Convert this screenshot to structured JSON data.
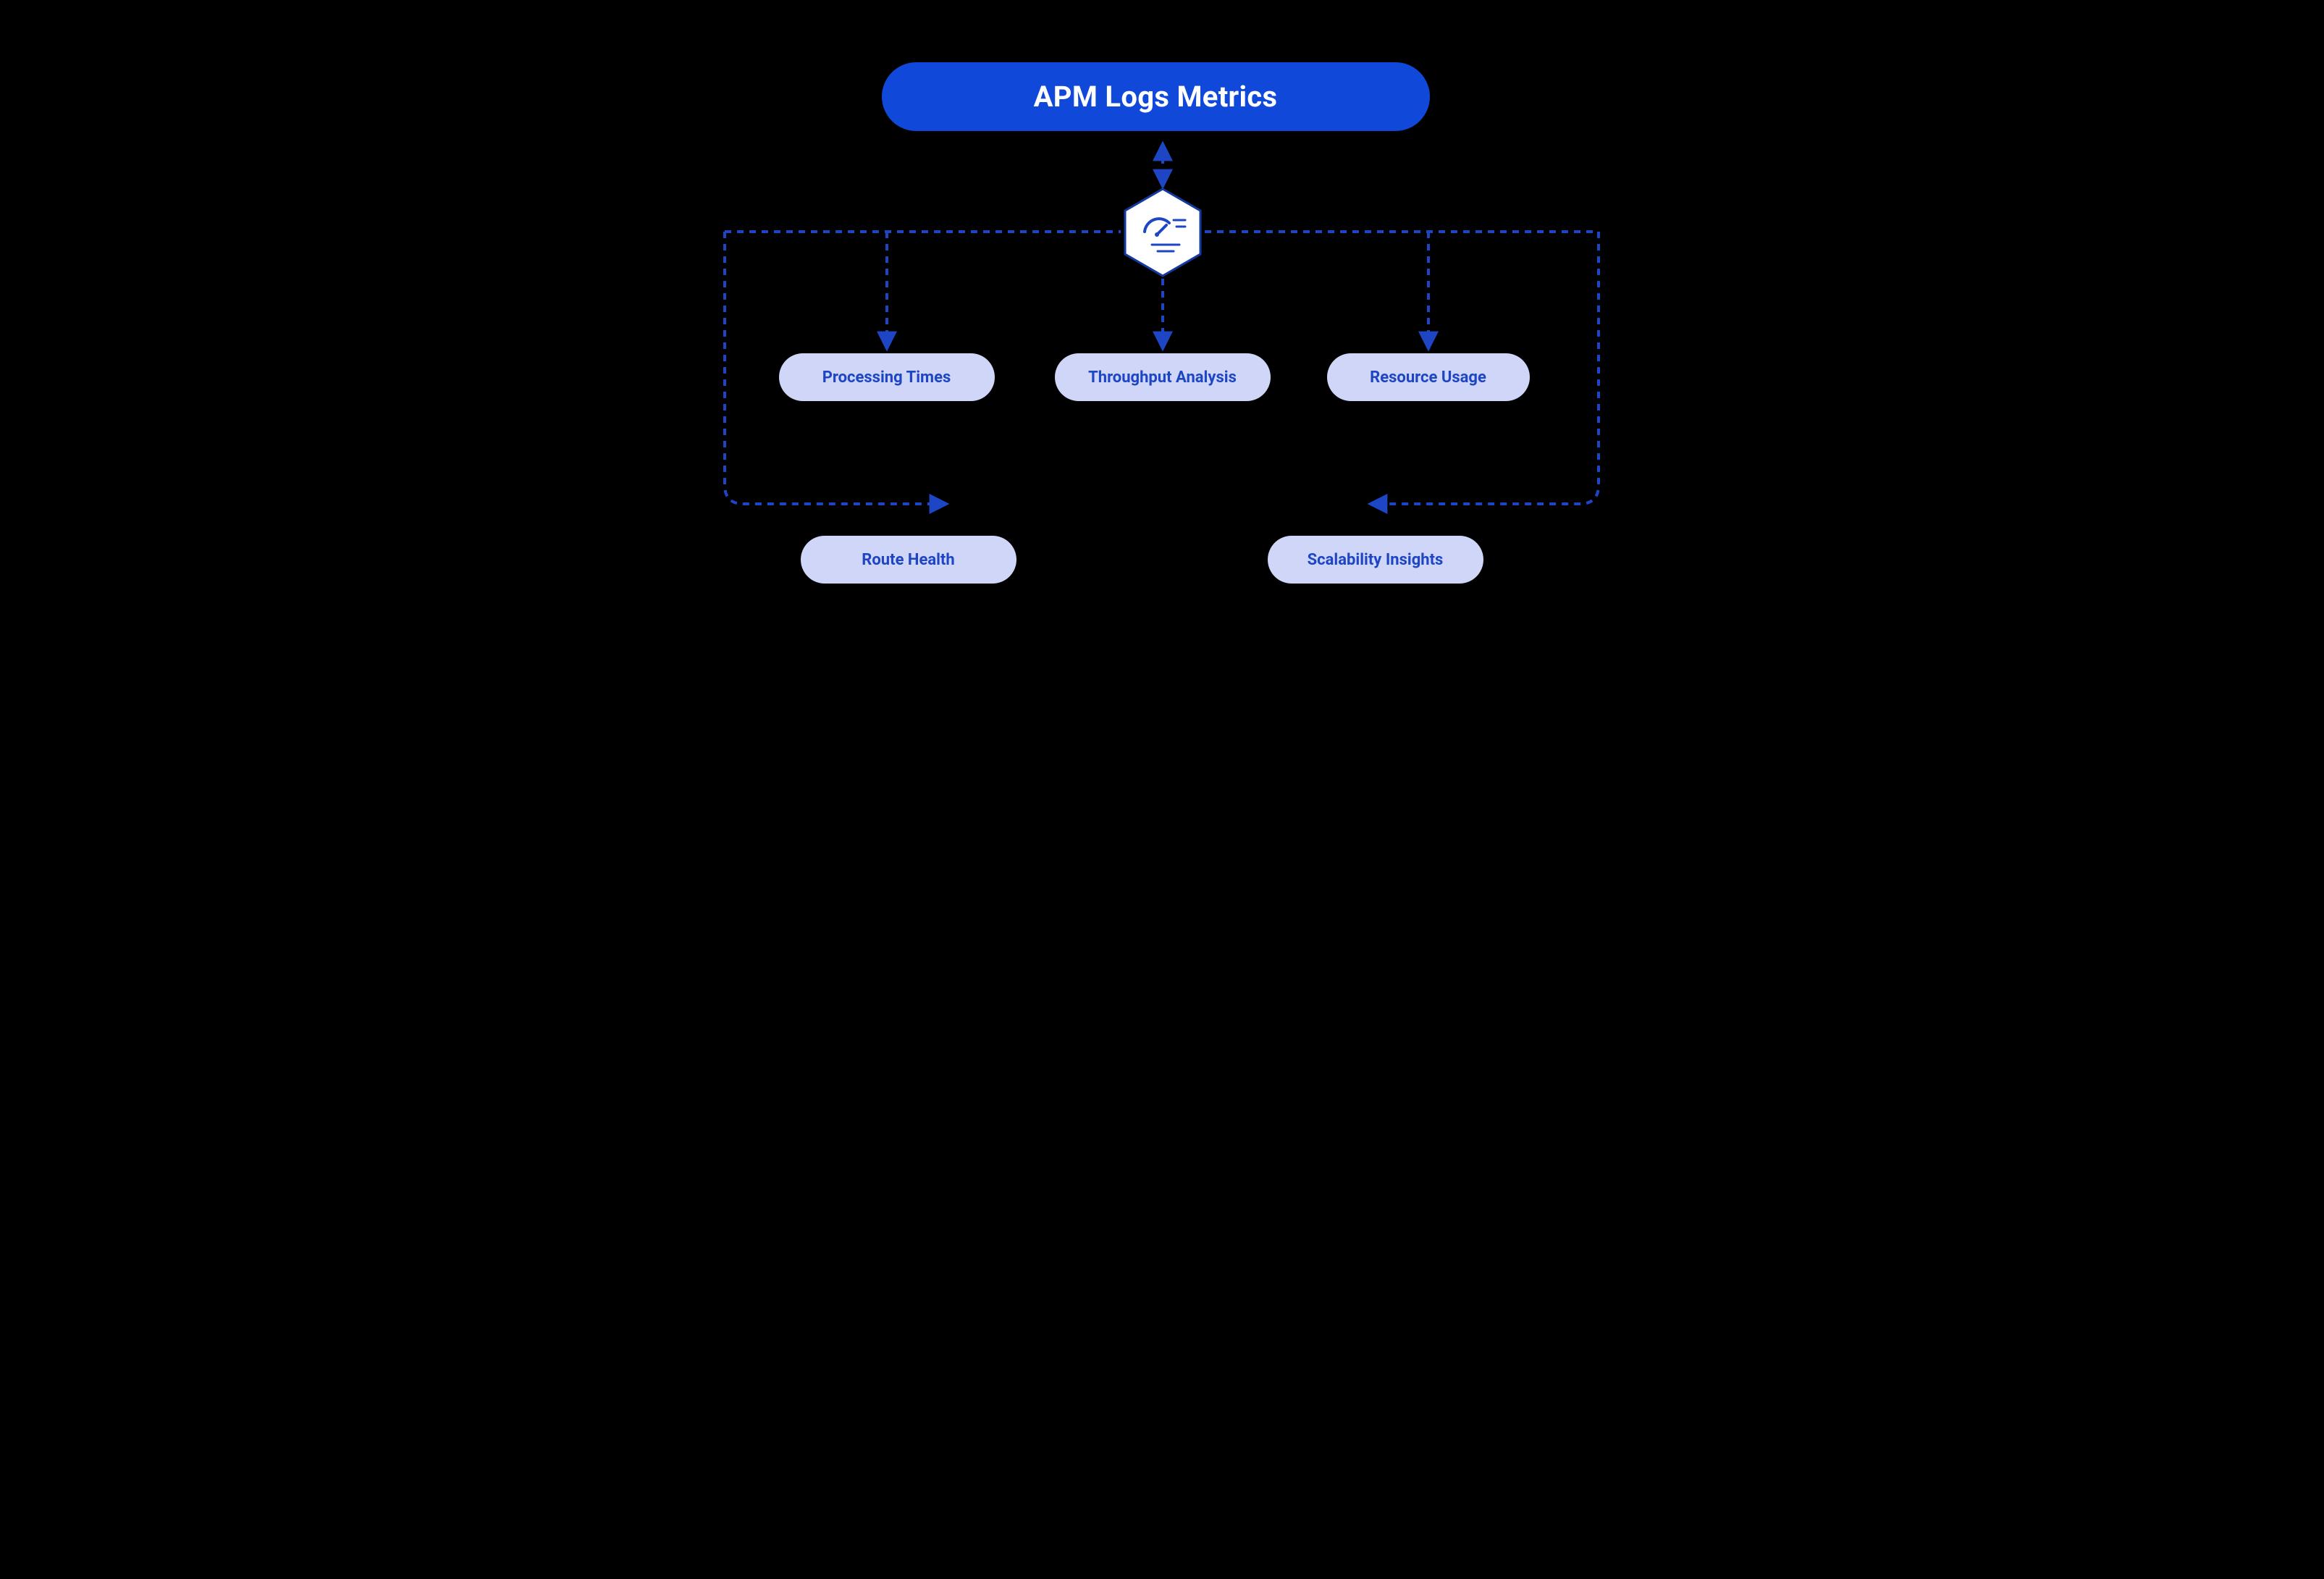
{
  "diagram": {
    "title": "APM Logs Metrics",
    "hub_icon": "gauge-icon",
    "children_row1": [
      {
        "label": "Processing Times"
      },
      {
        "label": "Throughput Analysis"
      },
      {
        "label": "Resource Usage"
      }
    ],
    "children_row2": [
      {
        "label": "Route Health"
      },
      {
        "label": "Scalability Insights"
      }
    ],
    "colors": {
      "title_bg": "#1049D9",
      "title_text": "#FFFFFF",
      "pill_bg": "#CFD6F7",
      "pill_text": "#1E46C4",
      "connector": "#1E46C4",
      "background": "#000000"
    }
  }
}
